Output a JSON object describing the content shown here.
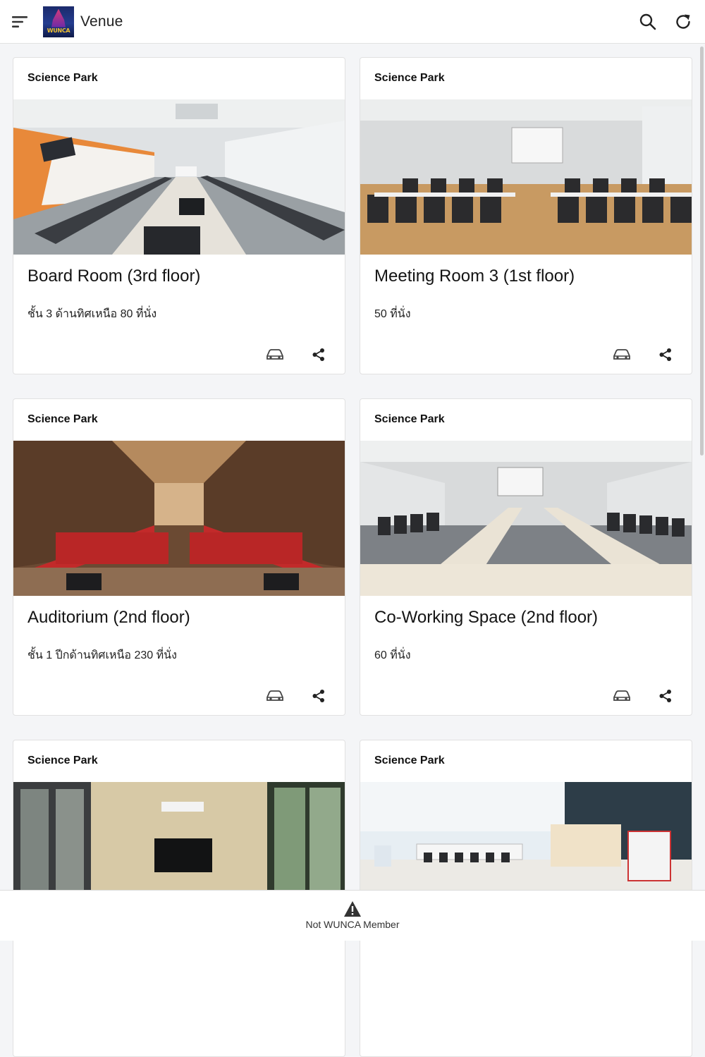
{
  "appbar": {
    "title": "Venue",
    "logo_text": "WUNCA",
    "icons": {
      "menu": "menu-icon",
      "search": "search-icon",
      "refresh": "refresh-icon"
    }
  },
  "venues": [
    {
      "category": "Science Park",
      "name": "Board Room (3rd floor)",
      "description": "ชั้น 3 ด้านทิศเหนือ 80 ที่นั่ง"
    },
    {
      "category": "Science Park",
      "name": "Meeting Room 3 (1st floor)",
      "description": "50 ที่นั่ง"
    },
    {
      "category": "Science Park",
      "name": "Auditorium (2nd floor)",
      "description": "ชั้น 1 ปีกด้านทิศเหนือ 230 ที่นั่ง"
    },
    {
      "category": "Science Park",
      "name": "Co-Working Space (2nd floor)",
      "description": "60 ที่นั่ง"
    },
    {
      "category": "Science Park",
      "name": "",
      "description": ""
    },
    {
      "category": "Science Park",
      "name": "",
      "description": ""
    }
  ],
  "card_icons": {
    "directions": "car-icon",
    "share": "share-icon"
  },
  "bottom_bar": {
    "label": "Not WUNCA Member",
    "icon": "warning-icon"
  },
  "colors": {
    "appbar_bg": "#ffffff",
    "page_bg": "#f4f5f7",
    "text": "#111111"
  }
}
